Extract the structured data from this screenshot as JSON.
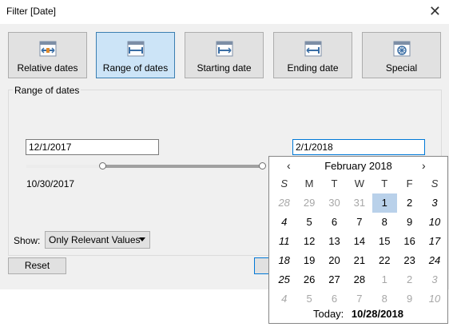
{
  "window": {
    "title": "Filter [Date]"
  },
  "tabs": [
    {
      "label": "Relative dates",
      "icon": "relative-dates-icon",
      "active": false
    },
    {
      "label": "Range of dates",
      "icon": "range-of-dates-icon",
      "active": true
    },
    {
      "label": "Starting date",
      "icon": "starting-date-icon",
      "active": false
    },
    {
      "label": "Ending date",
      "icon": "ending-date-icon",
      "active": false
    },
    {
      "label": "Special",
      "icon": "special-icon",
      "active": false
    }
  ],
  "range": {
    "group_title": "Range of dates",
    "start_value": "12/1/2017",
    "end_value": "2/1/2018",
    "min_label": "10/30/2017"
  },
  "show": {
    "label": "Show:",
    "selected": "Only Relevant Values"
  },
  "buttons": {
    "reset": "Reset"
  },
  "calendar": {
    "month_label": "February",
    "year_label": "2018",
    "prev_symbol": "‹",
    "next_symbol": "›",
    "weekdays": [
      "S",
      "M",
      "T",
      "W",
      "T",
      "F",
      "S"
    ],
    "weeks": [
      [
        "28",
        "29",
        "30",
        "31",
        "1",
        "2",
        "3"
      ],
      [
        "4",
        "5",
        "6",
        "7",
        "8",
        "9",
        "10"
      ],
      [
        "11",
        "12",
        "13",
        "14",
        "15",
        "16",
        "17"
      ],
      [
        "18",
        "19",
        "20",
        "21",
        "22",
        "23",
        "24"
      ],
      [
        "25",
        "26",
        "27",
        "28",
        "1",
        "2",
        "3"
      ],
      [
        "4",
        "5",
        "6",
        "7",
        "8",
        "9",
        "10"
      ]
    ],
    "selected_day": "1",
    "today_label": "Today:",
    "today_value": "10/28/2018"
  },
  "colors": {
    "active_tab": "#cce4f7",
    "selected_day": "#b9d1ea",
    "focus_border": "#0078d7"
  }
}
